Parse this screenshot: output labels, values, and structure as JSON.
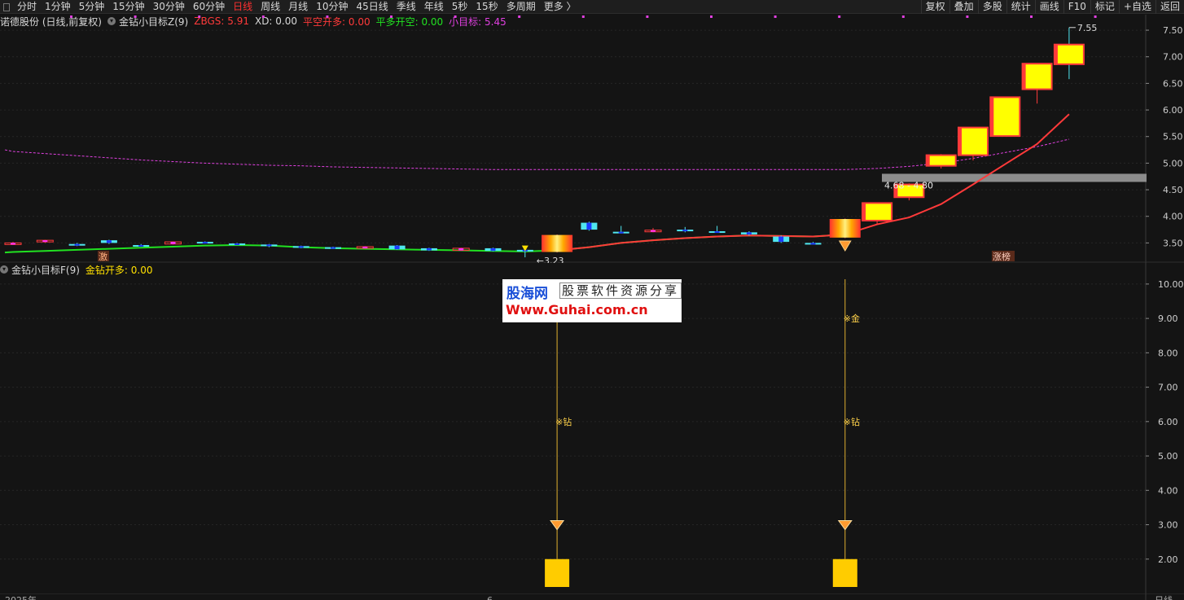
{
  "toolbar": {
    "periods": [
      "分时",
      "1分钟",
      "5分钟",
      "15分钟",
      "30分钟",
      "60分钟",
      "日线",
      "周线",
      "月线",
      "10分钟",
      "45日线",
      "季线",
      "年线",
      "5秒",
      "15秒",
      "多周期",
      "更多 〉"
    ],
    "active_period": "日线",
    "right_buttons": [
      "复权",
      "叠加",
      "多股",
      "统计",
      "画线",
      "F10",
      "标记",
      "+自选",
      "返回"
    ]
  },
  "upper_header": {
    "stock": "诺德股份 (日线,前复权)",
    "indicator": "金钻小目标Z(9)",
    "zbgs": "ZBGS: 5.91",
    "xd": "XD: 0.00",
    "pk_kd": "平空开多: 0.00",
    "pd_kk": "平多开空: 0.00",
    "target": "小目标: 5.45"
  },
  "lower_header": {
    "indicator": "金钻小目标F(9)",
    "value": "金钻开多: 0.00"
  },
  "upper_axis": [
    "7.50",
    "7.00",
    "6.50",
    "6.00",
    "5.50",
    "5.00",
    "4.50",
    "4.00",
    "3.50"
  ],
  "lower_axis": [
    "10.00",
    "9.00",
    "8.00",
    "7.00",
    "6.00",
    "5.00",
    "4.00",
    "3.00",
    "2.00"
  ],
  "annotations": {
    "high": "7.55",
    "low": "3.23",
    "band": "4.68 - 4.80",
    "tag_left": "激",
    "tag_right": "涨榜",
    "signal_jin": "※金",
    "signal_zuan": "※钻",
    "signal_zuan_left": "※钻"
  },
  "bottom_axis": {
    "year": "2025年",
    "month": "6",
    "period": "日线"
  },
  "logo": {
    "name": "股海网",
    "slogan": "股票软件资源分享",
    "url": "Www.Guhai.com.cn"
  },
  "colors": {
    "up": "#ff3a3a",
    "down": "#4fe6ef",
    "ma": "#21e121",
    "target": "#e040e0",
    "gold": "#ffcc00"
  },
  "chart_data": {
    "type": "candlestick",
    "y_range": [
      3.2,
      7.7
    ],
    "candles": [
      {
        "o": 3.49,
        "c": 3.5,
        "h": 3.52,
        "l": 3.46
      },
      {
        "o": 3.52,
        "c": 3.55,
        "h": 3.56,
        "l": 3.5
      },
      {
        "o": 3.48,
        "c": 3.46,
        "h": 3.5,
        "l": 3.44
      },
      {
        "o": 3.55,
        "c": 3.5,
        "h": 3.56,
        "l": 3.48
      },
      {
        "o": 3.46,
        "c": 3.45,
        "h": 3.48,
        "l": 3.43
      },
      {
        "o": 3.48,
        "c": 3.52,
        "h": 3.53,
        "l": 3.47
      },
      {
        "o": 3.52,
        "c": 3.51,
        "h": 3.53,
        "l": 3.49
      },
      {
        "o": 3.49,
        "c": 3.48,
        "h": 3.5,
        "l": 3.47
      },
      {
        "o": 3.47,
        "c": 3.44,
        "h": 3.48,
        "l": 3.42
      },
      {
        "o": 3.44,
        "c": 3.42,
        "h": 3.45,
        "l": 3.4
      },
      {
        "o": 3.42,
        "c": 3.4,
        "h": 3.43,
        "l": 3.39
      },
      {
        "o": 3.4,
        "c": 3.43,
        "h": 3.44,
        "l": 3.39
      },
      {
        "o": 3.45,
        "c": 3.38,
        "h": 3.46,
        "l": 3.37
      },
      {
        "o": 3.4,
        "c": 3.36,
        "h": 3.41,
        "l": 3.35
      },
      {
        "o": 3.36,
        "c": 3.4,
        "h": 3.41,
        "l": 3.35
      },
      {
        "o": 3.4,
        "c": 3.35,
        "h": 3.41,
        "l": 3.34
      },
      {
        "o": 3.37,
        "c": 3.34,
        "h": 3.38,
        "l": 3.23
      },
      {
        "o": 3.33,
        "c": 3.65,
        "h": 3.66,
        "l": 3.32
      },
      {
        "o": 3.88,
        "c": 3.75,
        "h": 3.9,
        "l": 3.73
      },
      {
        "o": 3.71,
        "c": 3.7,
        "h": 3.82,
        "l": 3.68
      },
      {
        "o": 3.72,
        "c": 3.74,
        "h": 3.78,
        "l": 3.7
      },
      {
        "o": 3.75,
        "c": 3.72,
        "h": 3.8,
        "l": 3.7
      },
      {
        "o": 3.72,
        "c": 3.71,
        "h": 3.82,
        "l": 3.7
      },
      {
        "o": 3.7,
        "c": 3.66,
        "h": 3.72,
        "l": 3.64
      },
      {
        "o": 3.62,
        "c": 3.52,
        "h": 3.64,
        "l": 3.5
      },
      {
        "o": 3.5,
        "c": 3.49,
        "h": 3.52,
        "l": 3.48
      },
      {
        "o": 3.6,
        "c": 3.95,
        "h": 3.96,
        "l": 3.59
      },
      {
        "o": 3.92,
        "c": 4.25,
        "h": 4.26,
        "l": 3.86
      },
      {
        "o": 4.36,
        "c": 4.6,
        "h": 4.62,
        "l": 4.3
      },
      {
        "o": 4.95,
        "c": 5.15,
        "h": 5.17,
        "l": 4.9
      },
      {
        "o": 5.15,
        "c": 5.67,
        "h": 5.68,
        "l": 5.05
      },
      {
        "o": 5.51,
        "c": 6.24,
        "h": 6.25,
        "l": 5.5
      },
      {
        "o": 6.39,
        "c": 6.87,
        "h": 6.88,
        "l": 6.12
      },
      {
        "o": 7.23,
        "c": 6.86,
        "h": 7.55,
        "l": 6.58
      }
    ],
    "ma_line": [
      3.33,
      3.35,
      3.37,
      3.39,
      3.41,
      3.43,
      3.45,
      3.46,
      3.45,
      3.42,
      3.4,
      3.39,
      3.38,
      3.37,
      3.36,
      3.35,
      3.34,
      3.36,
      3.42,
      3.5,
      3.55,
      3.59,
      3.62,
      3.64,
      3.63,
      3.62,
      3.66,
      3.85,
      3.98,
      4.23,
      4.6,
      4.98,
      5.36,
      5.92
    ],
    "target_line": [
      5.22,
      5.18,
      5.14,
      5.1,
      5.06,
      5.03,
      5.0,
      4.98,
      4.96,
      4.95,
      4.93,
      4.92,
      4.91,
      4.9,
      4.89,
      4.88,
      4.88,
      4.88,
      4.88,
      4.88,
      4.88,
      4.88,
      4.88,
      4.88,
      4.88,
      4.88,
      4.88,
      4.9,
      4.94,
      5.0,
      5.09,
      5.2,
      5.31,
      5.45
    ],
    "gold_candles": [
      17,
      26
    ],
    "lower_y_range": [
      1.0,
      10.4
    ],
    "lower_bars": [
      {
        "index": 17,
        "value": 2.0
      },
      {
        "index": 26,
        "value": 2.0
      }
    ]
  }
}
